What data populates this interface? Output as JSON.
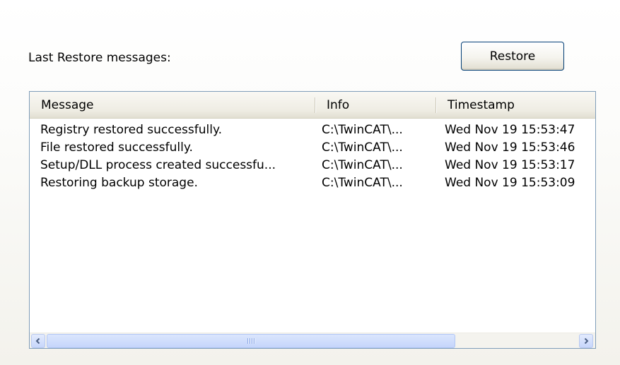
{
  "panel": {
    "label": "Last Restore messages:",
    "restore_button": "Restore"
  },
  "list": {
    "columns": [
      {
        "label": "Message"
      },
      {
        "label": "Info"
      },
      {
        "label": "Timestamp"
      }
    ],
    "rows": [
      {
        "message": "Registry restored successfully.",
        "info": "C:\\TwinCAT\\...",
        "timestamp": "Wed Nov 19 15:53:47"
      },
      {
        "message": "File restored successfully.",
        "info": "C:\\TwinCAT\\...",
        "timestamp": "Wed Nov 19 15:53:46"
      },
      {
        "message": "Setup/DLL process created successfu...",
        "info": "C:\\TwinCAT\\...",
        "timestamp": "Wed Nov 19 15:53:17"
      },
      {
        "message": "Restoring backup storage.",
        "info": "C:\\TwinCAT\\...",
        "timestamp": "Wed Nov 19 15:53:09"
      }
    ]
  },
  "scrollbar": {
    "left_icon": "scroll-left-arrow-icon",
    "right_icon": "scroll-right-arrow-icon",
    "thumb_grip_icon": "scroll-thumb-grip-icon"
  }
}
